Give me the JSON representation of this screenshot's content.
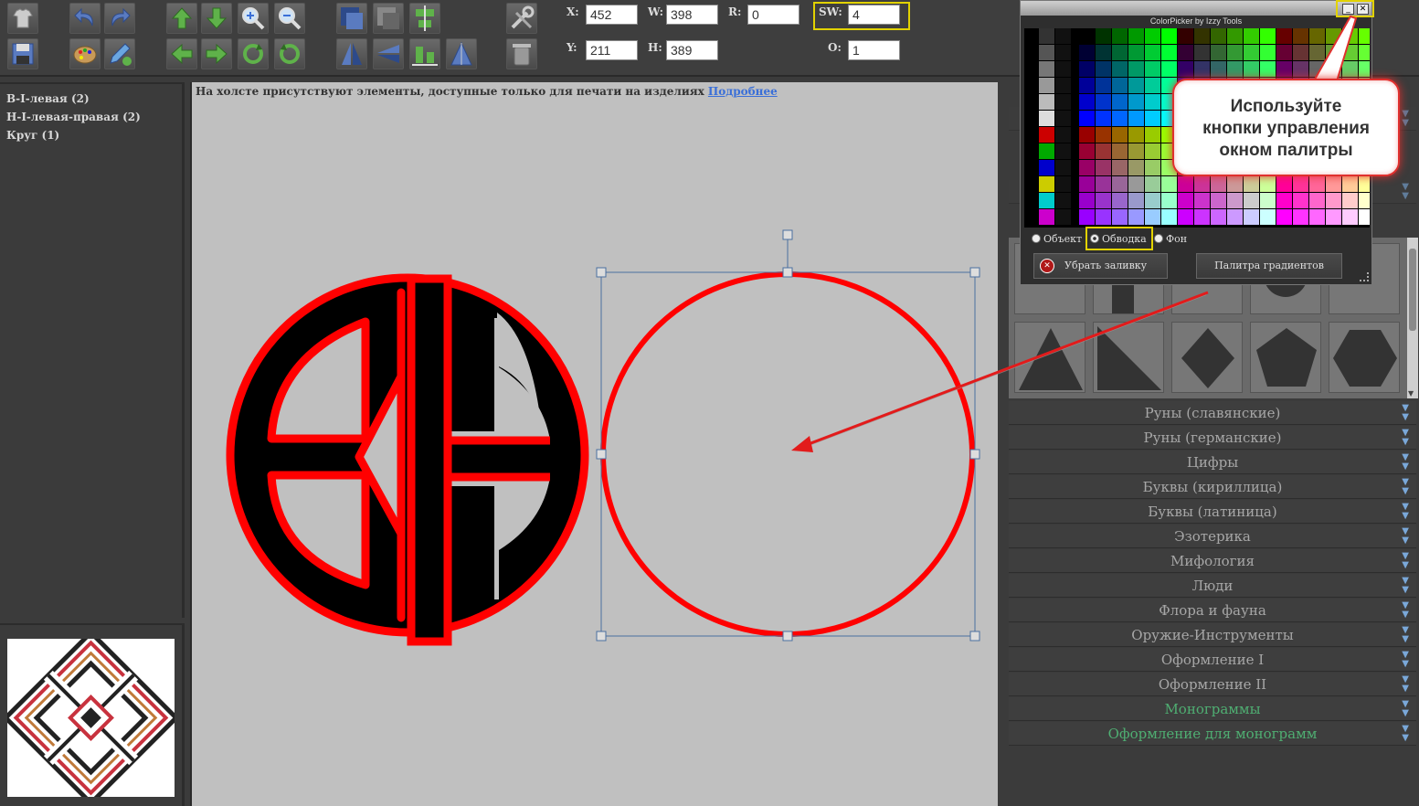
{
  "toolbar": {
    "buttons": [
      "shirt-icon",
      "undo-icon",
      "redo-icon",
      "move-up-icon",
      "move-down-icon",
      "zoom-in-icon",
      "zoom-out-icon",
      "bring-front-icon",
      "send-back-icon",
      "align-center-icon",
      "tools-icon",
      "save-icon",
      "palette-icon",
      "edit-icon",
      "move-left-icon",
      "move-right-icon",
      "rotate-cw-icon",
      "rotate-ccw-icon",
      "flip-vertical-icon",
      "flip-horizontal-icon",
      "align-bottom-icon",
      "mirror-icon",
      "trash-icon"
    ],
    "x_label": "X:",
    "x_value": "452",
    "w_label": "W:",
    "w_value": "398",
    "r_label": "R:",
    "r_value": "0",
    "sw_label": "SW:",
    "sw_value": "4",
    "y_label": "Y:",
    "y_value": "211",
    "h_label": "H:",
    "h_value": "389",
    "o_label": "O:",
    "o_value": "1"
  },
  "layers": [
    "В-I-левая (2)",
    "Н-I-левая-правая (2)",
    "Круг (1)"
  ],
  "canvas": {
    "notice": "На холсте присутствуют элементы, доступные только для печати на изделиях",
    "notice_link": "Подробнее"
  },
  "picker": {
    "title": "ColorPicker by Izzy Tools",
    "minimize": "_",
    "close": "✕",
    "radio_object": "Объект",
    "radio_stroke": "Обводка",
    "radio_fill": "Фон",
    "clear_fill": "Убрать заливку",
    "gradient_palette": "Палитра градиентов",
    "selected_target": "stroke"
  },
  "callout": {
    "line1": "Используйте",
    "line2": "кнопки управления",
    "line3": "окном палитры"
  },
  "categories": [
    {
      "label": "Руны (славянские)",
      "color": "#a7a7a7"
    },
    {
      "label": "Руны (германские)",
      "color": "#a7a7a7"
    },
    {
      "label": "Цифры",
      "color": "#a7a7a7"
    },
    {
      "label": "Буквы (кириллица)",
      "color": "#a7a7a7"
    },
    {
      "label": "Буквы (латиница)",
      "color": "#a7a7a7"
    },
    {
      "label": "Эзотерика",
      "color": "#a7a7a7"
    },
    {
      "label": "Мифология",
      "color": "#a7a7a7"
    },
    {
      "label": "Люди",
      "color": "#a7a7a7"
    },
    {
      "label": "Флора и фауна",
      "color": "#a7a7a7"
    },
    {
      "label": "Оружие-Инструменты",
      "color": "#a7a7a7"
    },
    {
      "label": "Оформление I",
      "color": "#a7a7a7"
    },
    {
      "label": "Оформление II",
      "color": "#a7a7a7"
    },
    {
      "label": "Монограммы",
      "color": "#4fae72"
    },
    {
      "label": "Оформление для монограмм",
      "color": "#4fae72"
    }
  ],
  "colors": {
    "stroke": "#ff0000",
    "fill": "#000000",
    "highlight": "#e2d200",
    "link": "#3a6fd8"
  }
}
